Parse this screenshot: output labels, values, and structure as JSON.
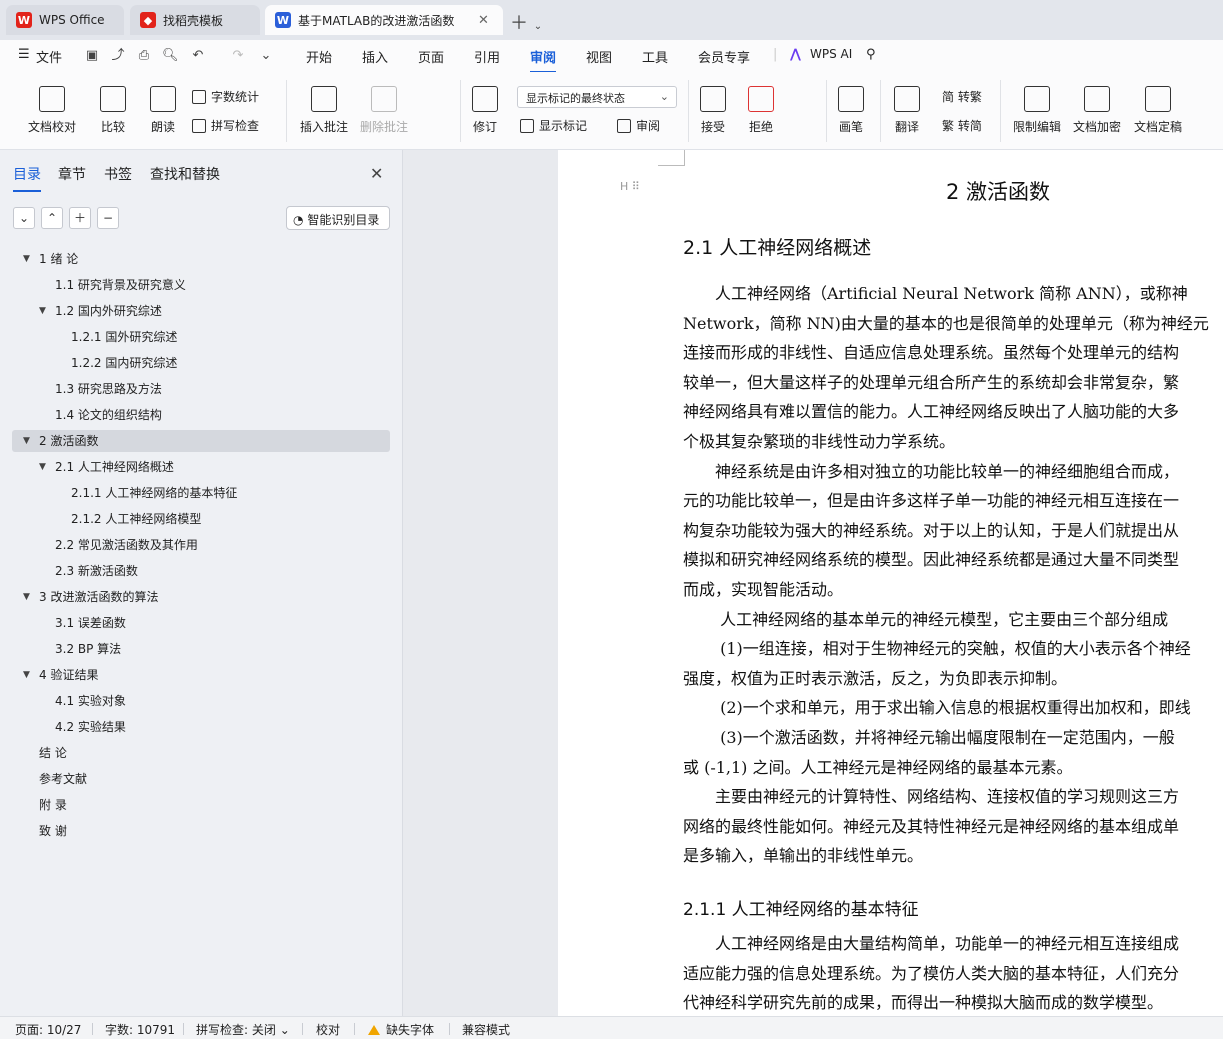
{
  "tabs": [
    {
      "label": "WPS Office",
      "logo_color": "#e2231a"
    },
    {
      "label": "找稻壳模板",
      "logo_color": "#e2231a"
    },
    {
      "label": "基于MATLAB的改进激活函数",
      "logo_color": "#2b5fd9"
    }
  ],
  "menu": {
    "file": "文件",
    "items": [
      "开始",
      "插入",
      "页面",
      "引用",
      "审阅",
      "视图",
      "工具",
      "会员专享"
    ],
    "active": "审阅",
    "wps_ai": "WPS AI"
  },
  "ribbon": {
    "doc_check": "文档校对",
    "compare": "比较",
    "read_aloud": "朗读",
    "word_count": "字数统计",
    "spell_check": "拼写检查",
    "insert_comment": "插入批注",
    "delete_comment": "删除批注",
    "revise": "修订",
    "markup_state": "显示标记的最终状态",
    "show_markup": "显示标记",
    "review_pane": "审阅",
    "accept": "接受",
    "reject": "拒绝",
    "pen": "画笔",
    "translate": "翻译",
    "to_traditional": "简 转繁",
    "to_simplified": "繁 转简",
    "restrict_edit": "限制编辑",
    "encrypt": "文档加密",
    "finalize": "文档定稿"
  },
  "nav": {
    "tabs": [
      "目录",
      "章节",
      "书签",
      "查找和替换"
    ],
    "active_tab": "目录",
    "smart_toc": "智能识别目录",
    "items": [
      {
        "text": "1  绪  论",
        "level": 0,
        "expanded": true
      },
      {
        "text": "1.1  研究背景及研究意义",
        "level": 1
      },
      {
        "text": "1.2 国内外研究综述",
        "level": 1,
        "expanded": true
      },
      {
        "text": "1.2.1 国外研究综述",
        "level": 2
      },
      {
        "text": "1.2.2  国内研究综述",
        "level": 2
      },
      {
        "text": "1.3 研究思路及方法",
        "level": 1
      },
      {
        "text": "1.4 论文的组织结构",
        "level": 1
      },
      {
        "text": "2  激活函数",
        "level": 0,
        "expanded": true,
        "selected": true
      },
      {
        "text": "2.1  人工神经网络概述",
        "level": 1,
        "expanded": true
      },
      {
        "text": "2.1.1  人工神经网络的基本特征",
        "level": 2
      },
      {
        "text": "2.1.2  人工神经网络模型",
        "level": 2
      },
      {
        "text": "2.2  常见激活函数及其作用",
        "level": 1
      },
      {
        "text": "2.3  新激活函数",
        "level": 1
      },
      {
        "text": "3  改进激活函数的算法",
        "level": 0,
        "expanded": true
      },
      {
        "text": "3.1  误差函数",
        "level": 1
      },
      {
        "text": "3.2    BP 算法",
        "level": 1
      },
      {
        "text": "4  验证结果",
        "level": 0,
        "expanded": true
      },
      {
        "text": "4.1  实验对象",
        "level": 1
      },
      {
        "text": "4.2  实验结果",
        "level": 1
      },
      {
        "text": "结  论",
        "level": 0
      },
      {
        "text": "参考文献",
        "level": 0
      },
      {
        "text": "附  录",
        "level": 0
      },
      {
        "text": "致  谢",
        "level": 0
      }
    ]
  },
  "document": {
    "chapter_title": "2  激活函数",
    "section_title": "2.1  人工神经网络概述",
    "lines": [
      "　　人工神经网络（Artificial Neural Network  简称 ANN），或称神",
      "Network，简称 NN)由大量的基本的也是很简单的处理单元（称为神经元",
      "连接而形成的非线性、自适应信息处理系统。虽然每个处理单元的结构",
      "较单一，但大量这样子的处理单元组合所产生的系统却会非常复杂，繁",
      "神经网络具有难以置信的能力。人工神经网络反映出了人脑功能的大多",
      "个极其复杂繁琐的非线性动力学系统。",
      "　　神经系统是由许多相对独立的功能比较单一的神经细胞组合而成，",
      "元的功能比较单一，但是由许多这样子单一功能的神经元相互连接在一",
      "构复杂功能较为强大的神经系统。对于以上的认知，于是人们就提出从",
      "模拟和研究神经网络系统的模型。因此神经系统都是通过大量不同类型",
      "而成，实现智能活动。",
      "　　 人工神经网络的基本单元的神经元模型，它主要由三个部分组成",
      "　　 (1)一组连接，相对于生物神经元的突触，权值的大小表示各个神经",
      "强度，权值为正时表示激活，反之，为负即表示抑制。",
      "　　 (2)一个求和单元，用于求出输入信息的根据权重得出加权和，即线",
      "　　 (3)一个激活函数，并将神经元输出幅度限制在一定范围内，一般",
      "或  (-1,1)  之间。人工神经元是神经网络的最基本元素。",
      "　　主要由神经元的计算特性、网络结构、连接权值的学习规则这三方",
      "网络的最终性能如何。神经元及其特性神经元是神经网络的基本组成单",
      "是多输入，单输出的非线性单元。"
    ],
    "subsection_title": "2.1.1  人工神经网络的基本特征",
    "lines2": [
      "　　人工神经网络是由大量结构简单，功能单一的神经元相互连接组成",
      "适应能力强的信息处理系统。为了模仿人类大脑的基本特征，人们充分",
      "代神经科学研究先前的成果，而得出一种模拟大脑而成的数学模型。"
    ]
  },
  "status": {
    "page": "页面: 10/27",
    "words": "字数: 10791",
    "spell": "拼写检查: 关闭",
    "proof": "校对",
    "missing_font": "缺失字体",
    "compat": "兼容模式"
  }
}
